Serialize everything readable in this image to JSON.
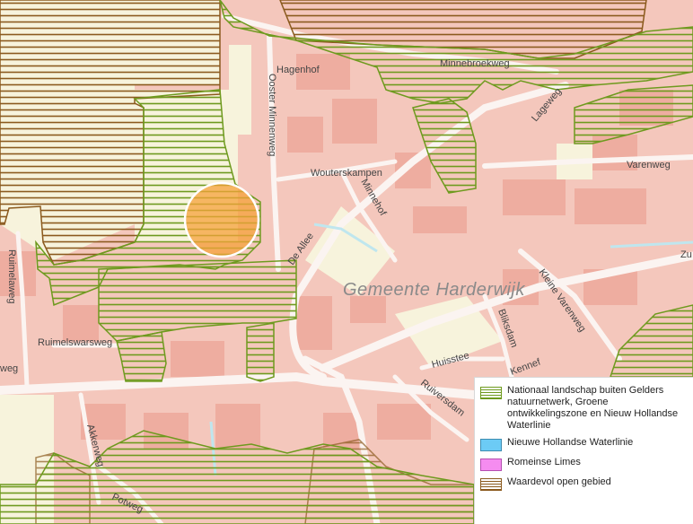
{
  "map": {
    "municipality_label": "Gemeente  Harderwijk",
    "streets": {
      "hagenhof": "Hagenhof",
      "oosterMinnenweg": "Ooster Minnenweg",
      "minnebroekweg": "Minnebroekweg",
      "lageweg": "Lageweg",
      "wouterskampen": "Wouterskampen",
      "minnehof": "Minnehof",
      "varenweg": "Varenweg",
      "deAllee": "De Allee",
      "ruimelaweg": "Ruimelaweg",
      "ruimelswarsweg": "Ruimelswarsweg",
      "weg": "weg",
      "kleineVarenweg": "Kleine Varenweg",
      "bliksdam": "Bliksdam",
      "huisstee": "Huisstee",
      "kennef": "Kennef",
      "ruiversdam": "Ruiversdam",
      "akkerweg": "Akkerweg",
      "potweg": "Potweg",
      "zu": "Zu"
    }
  },
  "legend": {
    "items": [
      {
        "label": "Nationaal landschap buiten Gelders natuurnetwerk, Groene ontwikkelingszone en Nieuw Hollandse Waterlinie",
        "swatch": "green-hatch",
        "color": "#6e9a1e"
      },
      {
        "label": "Nieuwe Hollandse Waterlinie",
        "swatch": "blue-fill",
        "color": "#6ccbf5"
      },
      {
        "label": "Romeinse Limes",
        "swatch": "pink-fill",
        "color": "#f58cf0"
      },
      {
        "label": "Waardevol open gebied",
        "swatch": "brown-hatch",
        "color": "#8b5a1e"
      }
    ]
  }
}
